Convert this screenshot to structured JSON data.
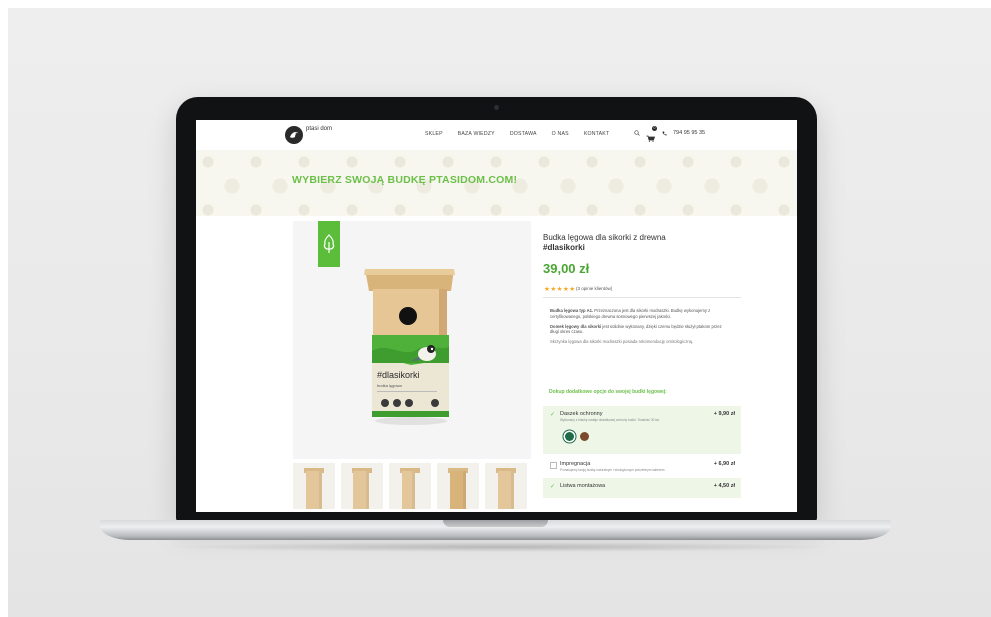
{
  "site": {
    "logo_text": "ptasi dom",
    "menu": [
      "SKLEP",
      "BAZA WIEDZY",
      "DOSTAWA",
      "O NAS",
      "KONTAKT"
    ],
    "cart_count": "0",
    "phone": "794 95 95 35"
  },
  "hero": {
    "title": "WYBIERZ SWOJĄ BUDKĘ PTASIDOM.COM!"
  },
  "product": {
    "title": "Budka lęgowa dla sikorki z drewna",
    "tag": "#dlasikorki",
    "price": "39,00 zł",
    "rating": 5,
    "reviews": "(3 opinie klientów)",
    "package_label": "#dlasikorki",
    "package_sub": "budka lęgowa",
    "desc": [
      {
        "bold": "Budka lęgowa typ A1.",
        "text": "Przeznaczona jest dla sikorki modraszki. Budkę wykonujemy z certyfikowanego, polskiego drewna sosnowego pierwszej jakości."
      },
      {
        "bold": "Domek lęgowy dla sikorki",
        "text": "jest solidnie wykonany, dzięki czemu będzie służył ptakom przez długi okres czasu."
      },
      {
        "bold": "",
        "text": "Skrzynka lęgowa dla sikorki modraszki posiada rekomendację ornitologiczną."
      }
    ],
    "promo": "Dokup dodatkowe opcje do swojej budki lęgowej:",
    "options": [
      {
        "name": "Daszek ochronny",
        "sub": "Wykonany z blachy nadaje dodatkowej ochrony budki. Trwałość 30 lat.",
        "price": "+ 9,90 zł",
        "checked": true
      },
      {
        "name": "Impregnacja",
        "sub": "Pomalujemy twoją budkę naturalnym i ekologicznym potrzebnym lakierem.",
        "price": "+ 6,90 zł",
        "checked": false
      },
      {
        "name": "Listwa montażowa",
        "sub": "",
        "price": "+ 4,50 zł",
        "checked": true
      }
    ],
    "swatch_colors": [
      "#1f6b47",
      "#7a4a2a"
    ]
  },
  "colors": {
    "accent": "#6cc04a",
    "price": "#4aa632"
  }
}
